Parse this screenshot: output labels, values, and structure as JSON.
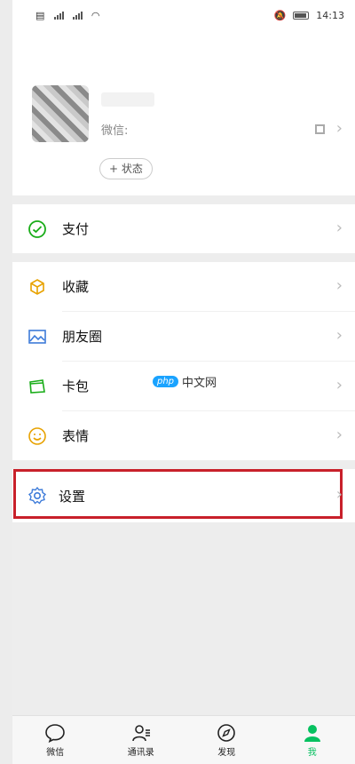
{
  "status_bar": {
    "left": "46 46",
    "time": "14:13"
  },
  "profile": {
    "wechat_id_label": "微信:",
    "status_button": "+ 状态"
  },
  "menu_payment": {
    "label": "支付"
  },
  "menu_items": [
    {
      "label": "收藏",
      "icon": "favorites-icon"
    },
    {
      "label": "朋友圈",
      "icon": "moments-icon"
    },
    {
      "label": "卡包",
      "icon": "card-wallet-icon"
    },
    {
      "label": "表情",
      "icon": "sticker-icon"
    }
  ],
  "settings": {
    "label": "设置"
  },
  "watermark": {
    "logo": "php",
    "text": "中文网"
  },
  "tabs": [
    {
      "label": "微信",
      "icon": "chat-icon"
    },
    {
      "label": "通讯录",
      "icon": "contacts-icon"
    },
    {
      "label": "发现",
      "icon": "discover-icon"
    },
    {
      "label": "我",
      "icon": "me-icon"
    }
  ],
  "colors": {
    "accent": "#07c160",
    "highlight_border": "#c8202a"
  }
}
